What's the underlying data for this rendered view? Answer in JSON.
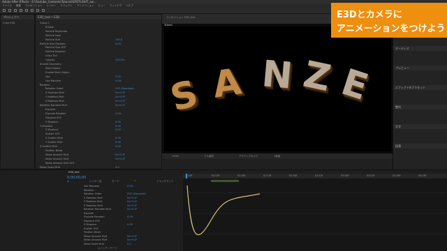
{
  "window": {
    "title": "Adobe After Effects - E:\\Youtube_Contents\\Tutorial\\SPOTLIGHT_sw...",
    "brand_color": "#ef8f0f"
  },
  "menus": [
    "ファイル",
    "編集",
    "コンポジション",
    "レイヤー",
    "エフェクト",
    "アニメーション",
    "ビュー",
    "ウィンドウ",
    "ヘルプ"
  ],
  "project_panel": {
    "title": "プロジェクト",
    "item": "Cube E3D"
  },
  "effects_panel": {
    "title": "E3D_text • E3D",
    "rows": [
      {
        "label": "Group 1",
        "value": ""
      },
      {
        "label": "Enable",
        "value": ""
      },
      {
        "label": "Particle Replicator",
        "value": ""
      },
      {
        "label": "Particle Look",
        "value": ""
      },
      {
        "label": "Particle Size",
        "value": "100.0"
      },
      {
        "label": "Particle Size Random",
        "value": "0.0%"
      },
      {
        "label": "Particle Size XYZ",
        "value": ""
      },
      {
        "label": "Particle Rotation",
        "value": ""
      },
      {
        "label": "Color Tint",
        "value": ""
      },
      {
        "label": "Opacity",
        "value": "100.0%"
      },
      {
        "label": "Shared Geometry",
        "value": ""
      },
      {
        "label": "Multi-Object",
        "value": ""
      },
      {
        "label": "Enable Multi-Object",
        "value": ""
      },
      {
        "label": "Use",
        "value": "0.00"
      },
      {
        "label": "Use Random",
        "value": "0.0%"
      },
      {
        "label": "Rotation",
        "value": ""
      },
      {
        "label": "Rotation Order",
        "value": "XYZ (Standard)"
      },
      {
        "label": "X Rotation Mult",
        "value": "0x+0.0°"
      },
      {
        "label": "Y Rotation Mult",
        "value": "0x+0.0°"
      },
      {
        "label": "Z Rotation Mult",
        "value": "0x+0.0°"
      },
      {
        "label": "Rotation Random Mult",
        "value": "0x+0.0°"
      },
      {
        "label": "Explode",
        "value": ""
      },
      {
        "label": "Explode Random",
        "value": "0.0%"
      },
      {
        "label": "Displace XYZ",
        "value": ""
      },
      {
        "label": "X Displace",
        "value": "0.00"
      },
      {
        "label": "Y Displace",
        "value": "0.00"
      },
      {
        "label": "Z Displace",
        "value": "0.00"
      },
      {
        "label": "Scatter XYZ",
        "value": ""
      },
      {
        "label": "X Scatter Mult",
        "value": "0.00"
      },
      {
        "label": "Y Scatter Mult",
        "value": "0.00"
      },
      {
        "label": "Z Scatter Mult",
        "value": "0.00"
      },
      {
        "label": "Position Noise",
        "value": ""
      },
      {
        "label": "Noise Amount Mult",
        "value": "0x+0.0°"
      },
      {
        "label": "Noise Amount Mult",
        "value": "0x+0.0°"
      },
      {
        "label": "Noise Amount Mult XYZ",
        "value": ""
      },
      {
        "label": "Noise Scale Mult",
        "value": "0.0"
      }
    ]
  },
  "comp_panel": {
    "tab": "コンポジション E3D_text",
    "name": "3Dtext",
    "letters": [
      "S",
      "A",
      "N",
      "Z",
      "E"
    ],
    "zoom": "100%",
    "resolution": "フル画質",
    "camera": "アクティブカメラ",
    "view": "1画面"
  },
  "banner": {
    "line1": "E3Dとカメラに",
    "line2": "アニメーションをつけよう"
  },
  "right_panel": {
    "title": "情報",
    "sections": [
      "オーディオ",
      "プレビュー",
      "エフェクト&プリセット",
      "整列",
      "文字",
      "段落"
    ]
  },
  "timeline": {
    "tab": "E3D_text",
    "timecode": "0;00;00;00",
    "columns": [
      "#",
      "レイヤー名",
      "モード",
      "T",
      "トラックマット"
    ],
    "rows": [
      {
        "label": "Use Random",
        "value": "0.0%"
      },
      {
        "label": "Rotation",
        "value": ""
      },
      {
        "label": "Rotation Order",
        "value": "XYZ (Standard)"
      },
      {
        "label": "X Rotation Mult",
        "value": "0x+0.0°"
      },
      {
        "label": "Y Rotation Mult",
        "value": "0x+0.0°"
      },
      {
        "label": "Z Rotation Mult",
        "value": "0x+0.0°"
      },
      {
        "label": "Rotation Random Mult",
        "value": "0x+0.0°"
      },
      {
        "label": "Explode",
        "value": ""
      },
      {
        "label": "Explode Random",
        "value": "0.0%"
      },
      {
        "label": "Displace XYZ",
        "value": ""
      },
      {
        "label": "Z Displace",
        "value": "0.00"
      },
      {
        "label": "Scatter XYZ",
        "value": ""
      },
      {
        "label": "Position Noise",
        "value": ""
      },
      {
        "label": "Noise Amount Mult",
        "value": "0x+0.0°"
      },
      {
        "label": "Noise Amount Mult",
        "value": "0x+0.0°"
      },
      {
        "label": "Noise Scale Mult",
        "value": "0.0"
      }
    ],
    "ruler_ticks": [
      "0:00f",
      "00:15f",
      "01:00f",
      "01:15f",
      "02:00f",
      "02:15f",
      "03:00f",
      "03:15f",
      "04:00f",
      "04:15f"
    ],
    "bottom": "スイッチ / モード"
  }
}
